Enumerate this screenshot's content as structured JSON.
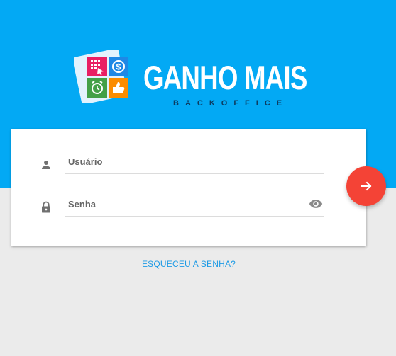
{
  "header": {
    "brand_name": "GANHO MAIS",
    "brand_subtitle": "BACKOFFICE",
    "background_color": "#03a9f4"
  },
  "login_form": {
    "username": {
      "placeholder": "Usuário",
      "value": "",
      "icon": "person-icon"
    },
    "password": {
      "placeholder": "Senha",
      "value": "",
      "icon": "lock-icon",
      "toggle_icon": "eye-icon"
    },
    "submit_icon": "arrow-right-icon",
    "submit_color": "#f44336"
  },
  "footer": {
    "forgot_password_label": "ESQUECEU A SENHA?",
    "link_color": "#1e9be5"
  }
}
